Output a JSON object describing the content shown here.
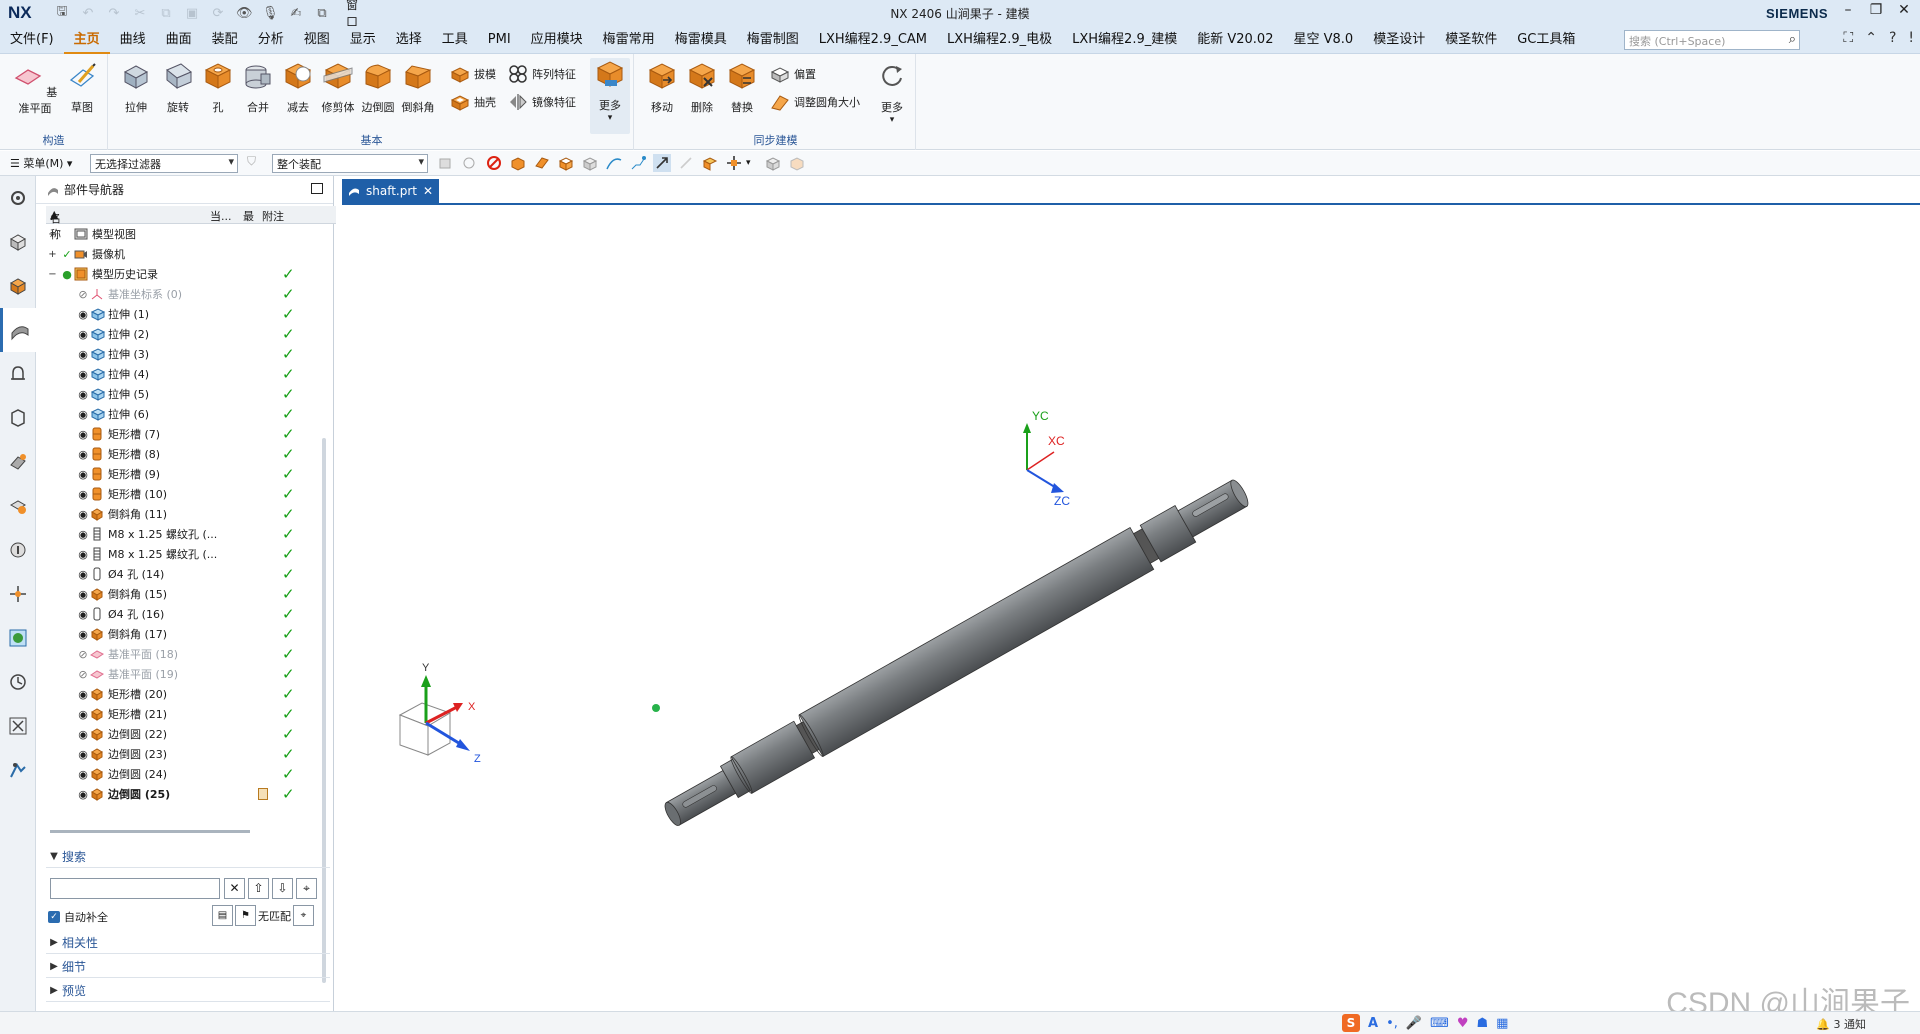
{
  "titlebar": {
    "logo": "NX",
    "window_menu": "窗口",
    "title": "NX 2406 山涧果子 - 建模",
    "brand": "SIEMENS"
  },
  "menubar": {
    "items": [
      "文件(F)",
      "主页",
      "曲线",
      "曲面",
      "装配",
      "分析",
      "视图",
      "显示",
      "选择",
      "工具",
      "PMI",
      "应用模块",
      "梅雷常用",
      "梅雷模具",
      "梅雷制图",
      "LXH编程2.9_CAM",
      "LXH编程2.9_电极",
      "LXH编程2.9_建模",
      "能新 V20.02",
      "星空 V8.0",
      "模圣设计",
      "模圣软件",
      "GC工具箱"
    ],
    "active_index": 1,
    "search_placeholder": "搜索 (Ctrl+Space)"
  },
  "ribbon": {
    "groups": {
      "construct": "构造",
      "basic": "基本",
      "sync": "同步建模"
    },
    "buttons": {
      "datum_plane": "基准平面",
      "sketch": "草图",
      "extrude": "拉伸",
      "revolve": "旋转",
      "hole": "孔",
      "unite": "合并",
      "subtract": "减去",
      "trim_body": "修剪体",
      "edge_blend": "边倒圆",
      "chamfer": "倒斜角",
      "draft": "拔模",
      "shell": "抽壳",
      "pattern_feature": "阵列特征",
      "mirror_feature": "镜像特征",
      "more_basic": "更多",
      "move": "移动",
      "delete": "删除",
      "replace": "替换",
      "offset": "偏置",
      "resize_blend": "调整圆角大小",
      "more_sync": "更多"
    }
  },
  "selbar": {
    "menu": "菜单(M)",
    "filter": "无选择过滤器",
    "scope": "整个装配"
  },
  "navigator": {
    "title": "部件导航器",
    "columns": {
      "name": "名称",
      "current": "当...",
      "latest": "最",
      "notes": "附注"
    },
    "top_nodes": [
      {
        "label": "模型视图",
        "expand": "+"
      },
      {
        "label": "摄像机",
        "expand": "+"
      },
      {
        "label": "模型历史记录",
        "expand": "−"
      }
    ],
    "features": [
      {
        "label": "基准坐标系 (0)",
        "type": "csys",
        "dim": true
      },
      {
        "label": "拉伸 (1)",
        "type": "extrude"
      },
      {
        "label": "拉伸 (2)",
        "type": "extrude"
      },
      {
        "label": "拉伸 (3)",
        "type": "extrude"
      },
      {
        "label": "拉伸 (4)",
        "type": "extrude"
      },
      {
        "label": "拉伸 (5)",
        "type": "extrude"
      },
      {
        "label": "拉伸 (6)",
        "type": "extrude"
      },
      {
        "label": "矩形槽 (7)",
        "type": "groove"
      },
      {
        "label": "矩形槽 (8)",
        "type": "groove"
      },
      {
        "label": "矩形槽 (9)",
        "type": "groove"
      },
      {
        "label": "矩形槽 (10)",
        "type": "groove"
      },
      {
        "label": "倒斜角 (11)",
        "type": "chamfer"
      },
      {
        "label": "M8 x 1.25 螺纹孔 (...",
        "type": "thread"
      },
      {
        "label": "M8 x 1.25 螺纹孔 (...",
        "type": "thread"
      },
      {
        "label": "Ø4 孔 (14)",
        "type": "hole"
      },
      {
        "label": "倒斜角 (15)",
        "type": "chamfer"
      },
      {
        "label": "Ø4 孔 (16)",
        "type": "hole"
      },
      {
        "label": "倒斜角 (17)",
        "type": "chamfer"
      },
      {
        "label": "基准平面 (18)",
        "type": "plane",
        "dim": true
      },
      {
        "label": "基准平面 (19)",
        "type": "plane",
        "dim": true
      },
      {
        "label": "矩形槽 (20)",
        "type": "chamfer"
      },
      {
        "label": "矩形槽 (21)",
        "type": "chamfer"
      },
      {
        "label": "边倒圆 (22)",
        "type": "chamfer"
      },
      {
        "label": "边倒圆 (23)",
        "type": "chamfer"
      },
      {
        "label": "边倒圆 (24)",
        "type": "chamfer"
      },
      {
        "label": "边倒圆 (25)",
        "type": "chamfer",
        "bold": true,
        "current": true
      }
    ],
    "search_section": "搜索",
    "auto_complete": "自动补全",
    "no_match": "无匹配",
    "sections": [
      "相关性",
      "细节",
      "预览"
    ]
  },
  "document": {
    "tab": "shaft.prt"
  },
  "viewport": {
    "csys_labels": {
      "yc": "YC",
      "xc": "XC",
      "zc": "ZC"
    },
    "triad_labels": {
      "y": "Y",
      "x": "X",
      "z": "Z"
    }
  },
  "statusbar": {
    "notifications": "3 通知",
    "watermark": "CSDN @山涧果子"
  },
  "colors": {
    "accent_orange": "#e08a12",
    "tab_blue": "#1f5fa8",
    "check_green": "#18a018",
    "shaft_gray": "#6e7275"
  }
}
